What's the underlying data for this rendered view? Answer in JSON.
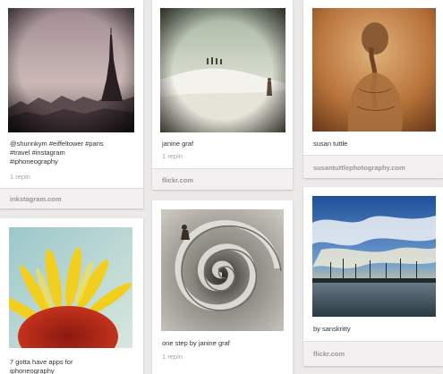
{
  "pins": [
    {
      "id": "eiffel",
      "description": "@shunnkym #eiffeltower #paris\n#travel #instagram\n#iphoneography",
      "repins": "1 repin",
      "source": "inkstagram.com"
    },
    {
      "id": "graf1",
      "description": "janine graf",
      "repins": "1 repin",
      "source": "flickr.com"
    },
    {
      "id": "tuttle",
      "description": "susan tuttle",
      "repins": "",
      "source": "susantuttlephotography.com"
    },
    {
      "id": "sunflower",
      "description": "7 gotta have apps for\niphoneography",
      "repins": "",
      "source": ""
    },
    {
      "id": "spiral",
      "description": "one step by janine graf",
      "repins": "1 repin",
      "source": ""
    },
    {
      "id": "harbor",
      "description": "by sanskritty",
      "repins": "",
      "source": "flickr.com"
    }
  ],
  "colors": {
    "background": "#ece9e9",
    "card": "#ffffff",
    "source_text": "#9b9797",
    "repin_text": "#a8a3a3"
  }
}
